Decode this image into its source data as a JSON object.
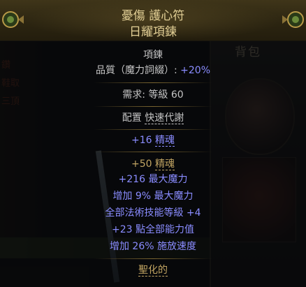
{
  "inventory": {
    "title": "背包",
    "left_texts": [
      "鑽",
      "鞋取",
      "三頂"
    ]
  },
  "item": {
    "name": "憂傷 護心符",
    "base_type": "日耀項鍊",
    "item_class": "項鍊",
    "quality_label": "品質（魔力詞綴）:",
    "quality_value": "+20%",
    "requirement_label": "需求:",
    "requirement_level_label": "等級",
    "requirement_level": "60",
    "anoint_prefix": "配置",
    "anoint_passive": "快速代謝",
    "enchant_value": "+16",
    "enchant_stat": "精魂",
    "implicit_value": "+50",
    "implicit_stat": "精魂",
    "explicit_mods": [
      "+216 最大魔力",
      "增加 9% 最大魔力",
      "全部法術技能等級 +4",
      "+23 點全部能力值",
      "增加 26% 施放速度"
    ],
    "footer": "聖化的"
  },
  "colors": {
    "header_name": "#e2cf95",
    "grey_text": "#c4c4c4",
    "magic_blue": "#8a8cff",
    "gold_text": "#c1a462"
  }
}
